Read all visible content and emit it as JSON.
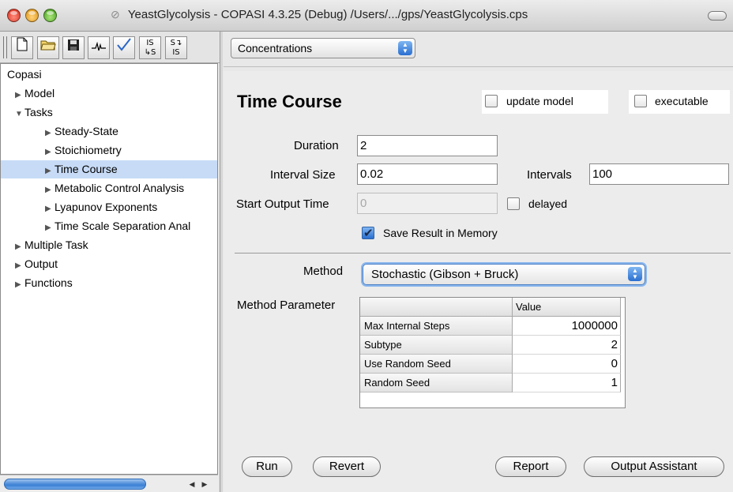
{
  "window": {
    "title": "YeastGlycolysis - COPASI 4.3.25 (Debug) /Users/.../gps/YeastGlycolysis.cps"
  },
  "toolbar": {
    "buttons": [
      {
        "icon": "new-document-icon",
        "glyph": "🗋"
      },
      {
        "icon": "open-folder-icon",
        "glyph": "📂"
      },
      {
        "icon": "save-disk-icon",
        "glyph": "💾"
      },
      {
        "icon": "graph-icon",
        "glyph": "⊶"
      },
      {
        "icon": "check-icon",
        "glyph": "✓"
      },
      {
        "icon": "is-convert-icon",
        "glyph": "IS\n↳S"
      },
      {
        "icon": "s-convert-icon",
        "glyph": "S↴\nIS"
      }
    ]
  },
  "tree": {
    "items": [
      {
        "label": "Copasi",
        "arrow": ""
      },
      {
        "label": "Model",
        "arrow": "▶"
      },
      {
        "label": "Tasks",
        "arrow": "▼"
      },
      {
        "label": "Steady-State",
        "arrow": "▶"
      },
      {
        "label": "Stoichiometry",
        "arrow": "▶"
      },
      {
        "label": "Time Course",
        "arrow": "▶"
      },
      {
        "label": "Metabolic Control Analysis",
        "arrow": "▶"
      },
      {
        "label": "Lyapunov Exponents",
        "arrow": "▶"
      },
      {
        "label": "Time Scale Separation Anal",
        "arrow": "▶"
      },
      {
        "label": "Multiple Task",
        "arrow": "▶"
      },
      {
        "label": "Output",
        "arrow": "▶"
      },
      {
        "label": "Functions",
        "arrow": "▶"
      }
    ]
  },
  "top_select": {
    "value": "Concentrations"
  },
  "task": {
    "title": "Time Course",
    "update_model": {
      "label": "update model",
      "checked": false
    },
    "executable": {
      "label": "executable",
      "checked": false
    },
    "duration": {
      "label": "Duration",
      "value": "2"
    },
    "interval_size": {
      "label": "Interval Size",
      "value": "0.02"
    },
    "intervals": {
      "label": "Intervals",
      "value": "100"
    },
    "start_output": {
      "label": "Start Output Time",
      "value": "0"
    },
    "delayed": {
      "label": "delayed",
      "checked": false
    },
    "save_result": {
      "label": "Save Result in Memory",
      "checked": true
    }
  },
  "method": {
    "label": "Method",
    "value": "Stochastic (Gibson + Bruck)",
    "param_label": "Method Parameter",
    "column": "Value",
    "params": [
      {
        "name": "Max Internal Steps",
        "value": "1000000"
      },
      {
        "name": "Subtype",
        "value": "2"
      },
      {
        "name": "Use Random Seed",
        "value": "0"
      },
      {
        "name": "Random Seed",
        "value": "1"
      }
    ]
  },
  "buttons": {
    "run": "Run",
    "revert": "Revert",
    "report": "Report",
    "output_assistant": "Output Assistant"
  }
}
